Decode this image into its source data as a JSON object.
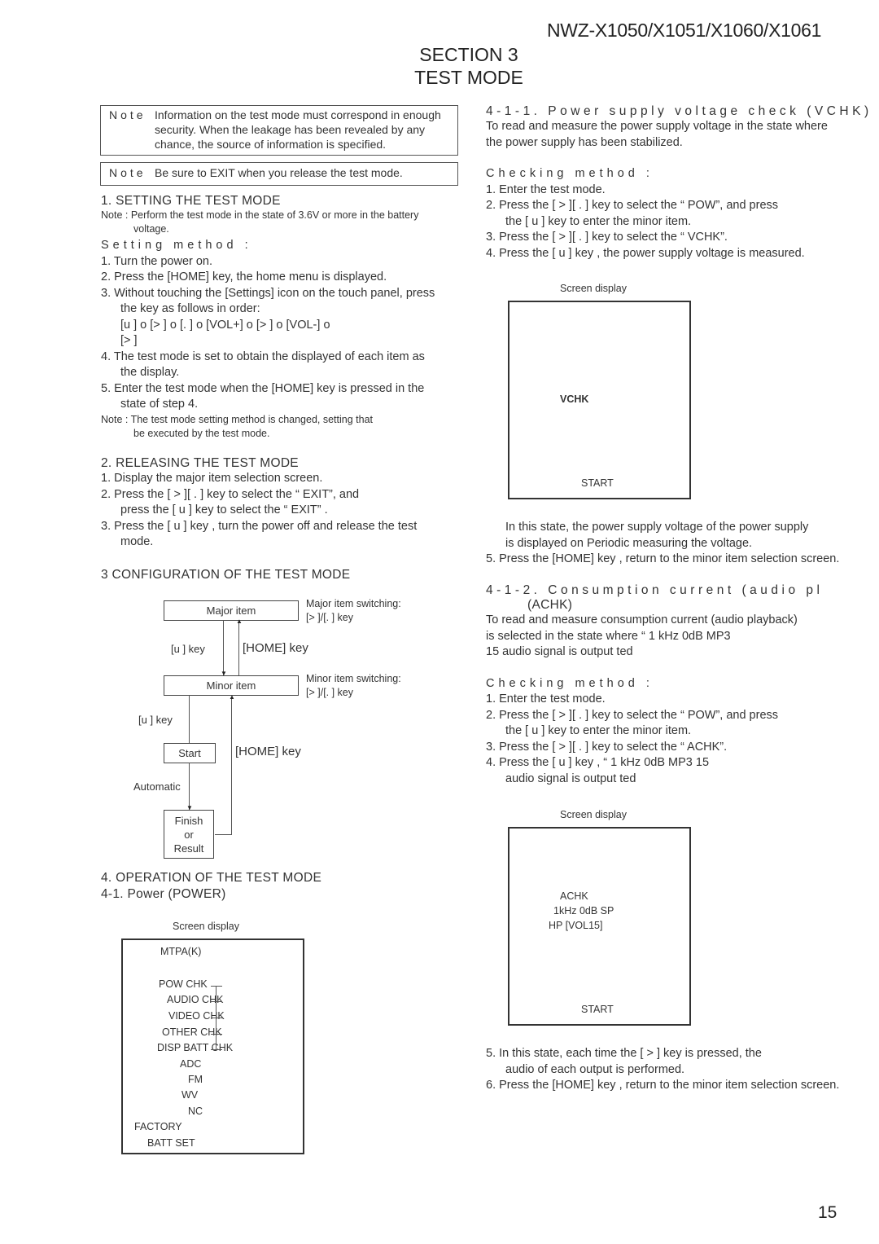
{
  "header": {
    "model": "NWZ-X1050/X1051/X1060/X1061",
    "section": "SECTION 3",
    "title": "TEST MODE"
  },
  "notes": {
    "label": "Note",
    "note1": [
      "Information on the test mode must correspond in enough",
      "security. When the leakage has been revealed by any",
      "chance, the source of information is specified."
    ],
    "note2": "Be sure to EXIT when you release the test mode."
  },
  "setting": {
    "heading": "1.  SETTING THE TEST MODE",
    "note": [
      "Note : Perform the test mode in the state of 3.6V or more in the battery",
      "voltage."
    ],
    "method": "Setting method :",
    "steps": [
      "1.  Turn the power on.",
      "2.  Press the [HOME] key, the home menu is displayed.",
      "3.  Without touching the [Settings] icon on the touch panel, press",
      "the key as follows in order:",
      "[u ]  o [>  ]  o [.  ]  o [VOL+]      o [>  ]  o [VOL-]      o",
      "[>  ]",
      "4.  The test mode is set to obtain the displayed of each item as",
      "the display.",
      "5.  Enter the test mode when the [HOME] key is pressed in the",
      "state of step 4."
    ],
    "note2": [
      "Note : The test mode setting method is changed, setting that",
      "be executed by the test mode."
    ]
  },
  "releasing": {
    "heading": "2.  RELEASING THE TEST MODE",
    "steps": [
      "1.  Display the major item selection screen.",
      "2.  Press the [   >   ][   .   ] key  to select the “ EXIT”, and",
      "press the [   u   ] key  to select the “ EXIT” .",
      "3.  Press the [   u   ] key , turn the power off and release the test",
      "mode."
    ]
  },
  "configuration": {
    "heading": "3  CONFIGURATION OF THE TEST MODE",
    "major_item": "Major item",
    "major_switch": [
      "Major item switching:",
      "[>    ]/[.    ] key"
    ],
    "minor_item": "Minor item",
    "minor_switch": [
      "Minor item switching:",
      "[>    ]/[.    ] key"
    ],
    "enter_key": "[u    ] key",
    "home_key": "[HOME] key",
    "start": "Start",
    "automatic": "Automatic",
    "finish": [
      "Finish",
      "or",
      "Result"
    ]
  },
  "operation": {
    "heading": "4.  OPERATION OF THE TEST MODE",
    "sub": "4-1.  Power  (POWER)",
    "screen_caption": "Screen display",
    "screen_lines": [
      "MTPA(K)",
      "POW CHK",
      "AUDIO CHK",
      "VIDEO CHK",
      "OTHER CHK",
      "DISP BATT CHK",
      "ADC",
      "FM",
      "WV",
      "NC",
      "FACTORY",
      "BATT SET"
    ]
  },
  "vchk": {
    "heading": "4-1-1.  Power  supply  voltage  check  (VCHK)",
    "desc": [
      "To read and measure the power supply voltage in the state where",
      "the power supply has been stabilized."
    ],
    "method": "Checking method :",
    "steps": [
      "1.  Enter the test mode.",
      "2.  Press the [     >   ][   .   ] key  to select the “ POW”, and press",
      "the [  u   ] key  to enter the minor item.",
      "3.  Press the [     >   ][   .   ] key  to select the “ VCHK”.",
      "4.  Press the [     u   ] key , the power supply voltage is measured."
    ],
    "screen_caption": "Screen display",
    "screen_value": "VCHK",
    "screen_start": "START",
    "after": [
      "In this state, the power supply voltage of the power supply",
      "is displayed on            Periodic measuring the voltage.",
      "5.  Press the [HOME] key , return to the minor item selection screen."
    ]
  },
  "achk": {
    "heading": "4-1-2.  Consumption  current  (audio  pl",
    "heading2": "(ACHK)",
    "desc": [
      "To read and measure consumption current (audio playback)",
      "is selected in the state where “ 1 kHz  0dB MP3",
      "15  audio signal is output ted"
    ],
    "method": "Checking method :",
    "steps": [
      "1.  Enter the test mode.",
      "2.  Press the [     >   ][   .   ] key  to select the “ POW”, and press",
      "the [  u   ] key  to enter the minor item.",
      "3.  Press the [     >   ][   .   ] key  to select the “ ACHK”.",
      "4.  Press the [     u   ] key , “ 1 kHz  0dB MP3 15",
      "audio signal is output ted"
    ],
    "screen_caption": "Screen display",
    "screen_lines": [
      "ACHK",
      "1kHz 0dB SP",
      "HP [VOL15]"
    ],
    "screen_start": "START",
    "after": [
      "5.  In this state, each time the [                 >   ] key  is pressed, the",
      "audio of each output is performed.",
      "6.  Press the [HOME] key , return to the minor item selection screen."
    ]
  },
  "footer": {
    "page_number": "15"
  }
}
